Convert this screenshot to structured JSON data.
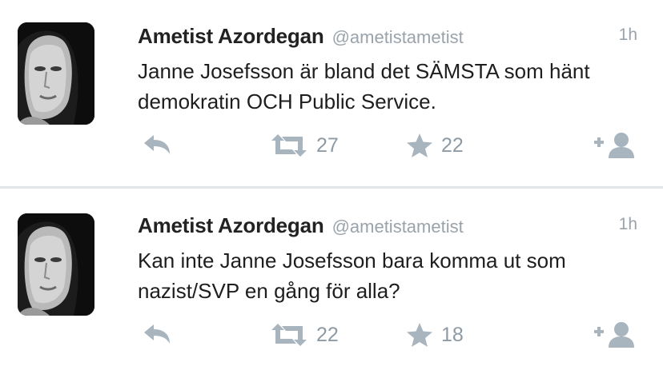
{
  "tweets": [
    {
      "author_name": "Ametist Azordegan",
      "handle": "@ametistametist",
      "time": "1h",
      "text": "Janne Josefsson är bland det SÄMSTA som hänt demokratin OCH Public Service.",
      "retweets": "27",
      "favorites": "22",
      "icons": [
        "reply-icon",
        "retweet-icon",
        "star-icon",
        "follow-icon"
      ]
    },
    {
      "author_name": "Ametist Azordegan",
      "handle": "@ametistametist",
      "time": "1h",
      "text": "Kan inte Janne Josefsson bara komma ut som nazist/SVP en gång för alla?",
      "retweets": "22",
      "favorites": "18",
      "icons": [
        "reply-icon",
        "retweet-icon",
        "star-icon",
        "follow-icon"
      ]
    }
  ],
  "colors": {
    "action_icon": "#a8b4be",
    "handle": "#9aa3ab",
    "divider": "#e3e6e9"
  }
}
